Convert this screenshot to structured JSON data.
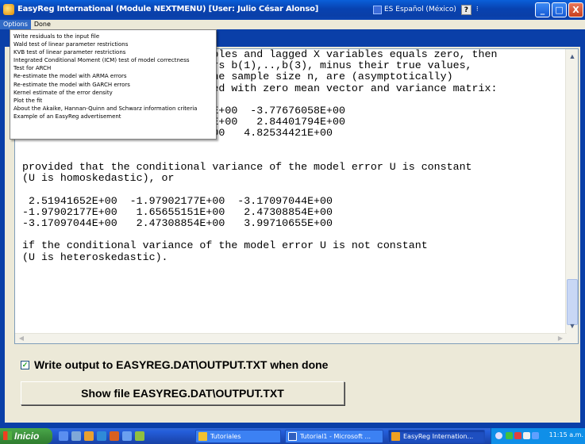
{
  "window": {
    "title": "EasyReg International (Module NEXTMENU) [User: Julio César Alonso]",
    "language": "ES Español (México)",
    "help_glyph": "?",
    "options_glyph": "⁝",
    "minimize_glyph": "_",
    "maximize_glyph": "□",
    "close_glyph": "X"
  },
  "menubar": {
    "items": [
      "Options",
      "Done"
    ]
  },
  "dropdown": {
    "items": [
      "Write residuals to the input file",
      "Wald test of linear parameter restrictions",
      "KVB test of linear parameter restrictions",
      "Integrated Conditional Moment (ICM) test of model correctness",
      "Test for ARCH",
      "Re-estimate the model with ARMA errors",
      "Re-estimate the model with GARCH errors",
      "Kernel estimate of the error density",
      "Plot the fit",
      "About the Akaike, Hannan-Quinn and Schwarz information criteria",
      "Example of an EasyReg advertisement"
    ]
  },
  "output": {
    "lines": [
      "                              bles and lagged X variables equals zero, then",
      "                              rs b(1),..,b(3), minus their true values,",
      "                              he sample size n, are (asymptotically)",
      "                              ed with zero mean vector and variance matrix:",
      "",
      "                             3E+00  -3.77676058E+00",
      "                             3E+00   2.84401794E+00",
      "-3.77676058E+00   2.84401794E+00   4.82534421E+00",
      "",
      "",
      "provided that the conditional variance of the model error U is constant",
      "(U is homoskedastic), or",
      "",
      " 2.51941652E+00  -1.97902177E+00  -3.17097044E+00",
      "-1.97902177E+00   1.65655151E+00   2.47308854E+00",
      "-3.17097044E+00   2.47308854E+00   3.99710655E+00",
      "",
      "if the conditional variance of the model error U is not constant",
      "(U is heteroskedastic)."
    ]
  },
  "checkbox": {
    "label": "Write output to EASYREG.DAT\\OUTPUT.TXT when done",
    "checked": true,
    "check_glyph": "✓"
  },
  "show_button": {
    "label": "Show file EASYREG.DAT\\OUTPUT.TXT"
  },
  "taskbar": {
    "start_label": "Inicio",
    "tasks": [
      {
        "label": "Tutoriales",
        "icon": "folder-icon",
        "color": "#f2c230"
      },
      {
        "label": "Tutorial1 - Microsoft ...",
        "icon": "word-icon",
        "color": "#2f5fbf"
      },
      {
        "label": "EasyReg Internation...",
        "icon": "easyreg-icon",
        "color": "#f0a020"
      }
    ],
    "clock": "11:15 a.m."
  },
  "colors": {
    "title_blue": "#0a3fa8",
    "menu_highlight": "#316ac5",
    "start_green": "#3c8f3c"
  }
}
